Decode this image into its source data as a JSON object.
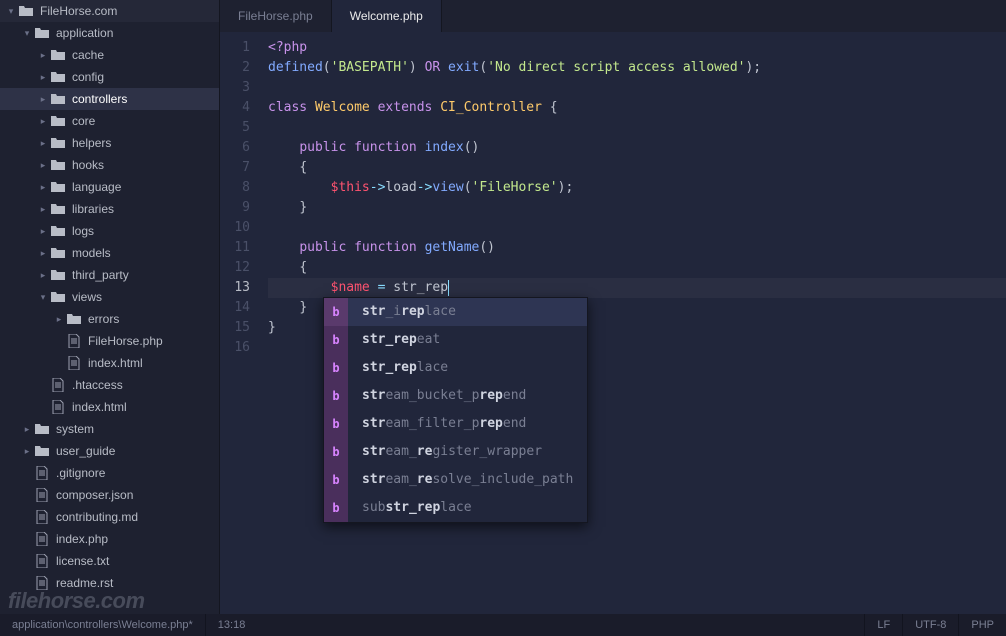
{
  "sidebar": {
    "root": "FileHorse.com",
    "app": "application",
    "folders": [
      "cache",
      "config",
      "controllers",
      "core",
      "helpers",
      "hooks",
      "language",
      "libraries",
      "logs",
      "models",
      "third_party"
    ],
    "views": "views",
    "errors": "errors",
    "view_files": [
      "FileHorse.php",
      "index.html"
    ],
    "app_files": [
      ".htaccess",
      "index.html"
    ],
    "top_dirs": [
      "system",
      "user_guide"
    ],
    "root_files": [
      ".gitignore",
      "composer.json",
      "contributing.md",
      "index.php",
      "license.txt",
      "readme.rst"
    ]
  },
  "tabs": [
    {
      "label": "FileHorse.php",
      "active": false
    },
    {
      "label": "Welcome.php",
      "active": true
    }
  ],
  "code": {
    "lines": [
      "<?php",
      "defined('BASEPATH') OR exit('No direct script access allowed');",
      "",
      "class Welcome extends CI_Controller {",
      "",
      "    public function index()",
      "    {",
      "        $this->load->view('FileHorse');",
      "    }",
      "",
      "    public function getName()",
      "    {",
      "        $name = str_rep",
      "    }",
      "}",
      ""
    ],
    "current_line": 13
  },
  "autocomplete": {
    "badge": "b",
    "items": [
      {
        "pre": "",
        "m1": "str",
        "mid": "_i",
        "m2": "rep",
        "post": "lace",
        "sel": true
      },
      {
        "pre": "",
        "m1": "str_rep",
        "mid": "",
        "m2": "",
        "post": "eat",
        "sel": false
      },
      {
        "pre": "",
        "m1": "str_rep",
        "mid": "",
        "m2": "",
        "post": "lace",
        "sel": false
      },
      {
        "pre": "",
        "m1": "str",
        "mid": "eam_bucket_p",
        "m2": "rep",
        "post": "end",
        "sel": false
      },
      {
        "pre": "",
        "m1": "str",
        "mid": "eam_filter_p",
        "m2": "rep",
        "post": "end",
        "sel": false
      },
      {
        "pre": "",
        "m1": "str",
        "mid": "eam_",
        "m2": "re",
        "post": "gister_wrapper",
        "sel": false
      },
      {
        "pre": "",
        "m1": "str",
        "mid": "eam_",
        "m2": "re",
        "post": "solve_include_path",
        "sel": false
      },
      {
        "pre": "sub",
        "m1": "str_rep",
        "mid": "",
        "m2": "",
        "post": "lace",
        "sel": false
      }
    ]
  },
  "statusbar": {
    "path": "application\\controllers\\Welcome.php*",
    "pos": "13:18",
    "eol": "LF",
    "enc": "UTF-8",
    "lang": "PHP"
  },
  "watermark": "filehorse.com"
}
